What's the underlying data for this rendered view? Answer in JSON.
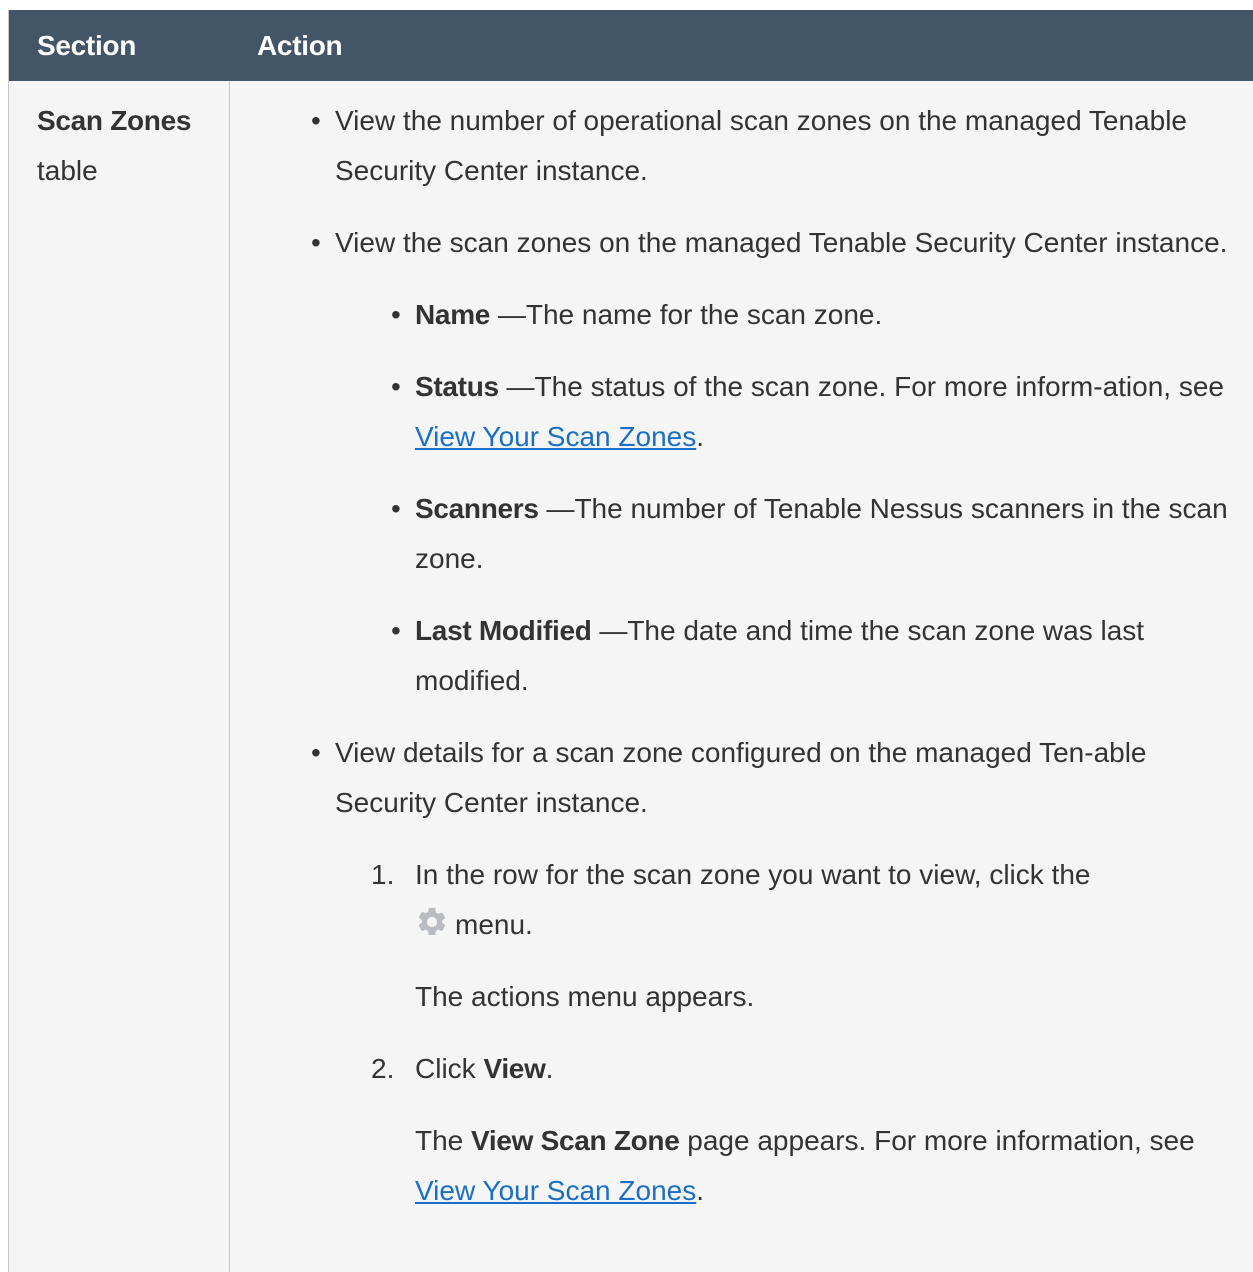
{
  "header": {
    "section": "Section",
    "action": "Action"
  },
  "row": {
    "section_bold": "Scan Zones",
    "section_rest": "table",
    "bullets": {
      "b1": "View the number of operational scan zones on the managed Tenable Security Center instance.",
      "b2": "View the scan zones on the managed Tenable Security Center instance.",
      "b3": "View details for a scan zone configured on the managed Ten-able Security Center instance."
    },
    "fields": {
      "name_label": "Name",
      "name_desc": " —The name for the scan zone.",
      "status_label": "Status",
      "status_desc": " —The status of the scan zone. For more inform-ation, see ",
      "status_link": "View Your Scan Zones",
      "status_end": ".",
      "scanners_label": "Scanners",
      "scanners_desc": " —The number of Tenable Nessus scanners in the scan zone.",
      "lastmod_label": "Last Modified",
      "lastmod_desc": " —The date and time the scan zone was last modified."
    },
    "steps": {
      "s1_num": "1.",
      "s1_text": "In the row for the scan zone you want to view, click the",
      "s1_icon": "gear-icon",
      "s1_menu": "menu.",
      "s1_after": "The actions menu appears.",
      "s2_num": "2.",
      "s2_pre": "Click ",
      "s2_bold": "View",
      "s2_end": ".",
      "s2_after_pre": "The ",
      "s2_after_bold": "View Scan Zone",
      "s2_after_mid": " page appears. For more information, see ",
      "s2_after_link": "View Your Scan Zones",
      "s2_after_end": "."
    }
  },
  "colors": {
    "header_bg": "#435667",
    "cell_bg": "#f5f5f5",
    "link": "#1a6ec7"
  }
}
